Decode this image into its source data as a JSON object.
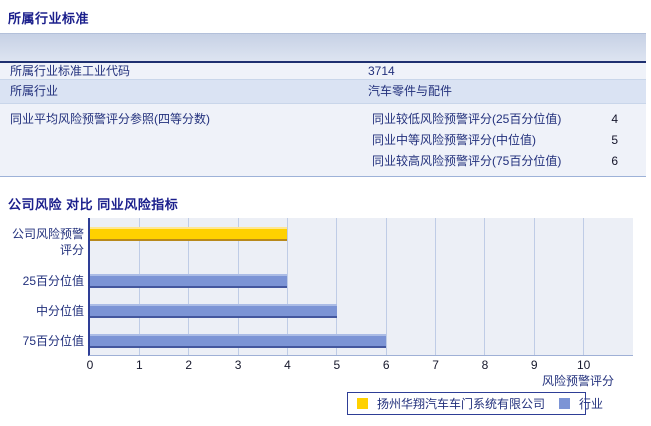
{
  "section1": {
    "title": "所属行业标准",
    "table": {
      "rows": [
        {
          "label": "所属行业标准工业代码",
          "value": "3714"
        },
        {
          "label": "所属行业",
          "value": "汽车零件与配件"
        },
        {
          "label": "同业平均风险预警评分参照(四等分数)",
          "sub_rows": [
            {
              "label": "同业较低风险预警评分(25百分位值)",
              "value": "4"
            },
            {
              "label": "同业中等风险预警评分(中位值)",
              "value": "5"
            },
            {
              "label": "同业较高风险预警评分(75百分位值)",
              "value": "6"
            }
          ]
        }
      ]
    }
  },
  "section2": {
    "title": "公司风险 对比 同业风险指标"
  },
  "chart_data": {
    "type": "bar",
    "orientation": "horizontal",
    "categories": [
      "公司风险预警评分",
      "25百分位值",
      "中分位值",
      "75百分位值"
    ],
    "values": [
      4,
      4,
      5,
      6
    ],
    "bar_series": [
      "company",
      "industry",
      "industry",
      "industry"
    ],
    "series_colors": {
      "company": "#FFD100",
      "industry": "#7C94D5"
    },
    "xlabel": "风险预警评分",
    "x_ticks": [
      0,
      1,
      2,
      3,
      4,
      5,
      6,
      7,
      8,
      9,
      10
    ],
    "xlim": [
      0,
      11
    ],
    "grid": "vertical",
    "plot_bg": "#ECEFF6",
    "legend_position": "bottom-right",
    "legend": [
      {
        "label": "扬州华翔汽车车门系统有限公司",
        "color": "#FFD100",
        "series": "company"
      },
      {
        "label": "行业",
        "color": "#7C94D5",
        "series": "industry"
      }
    ]
  }
}
